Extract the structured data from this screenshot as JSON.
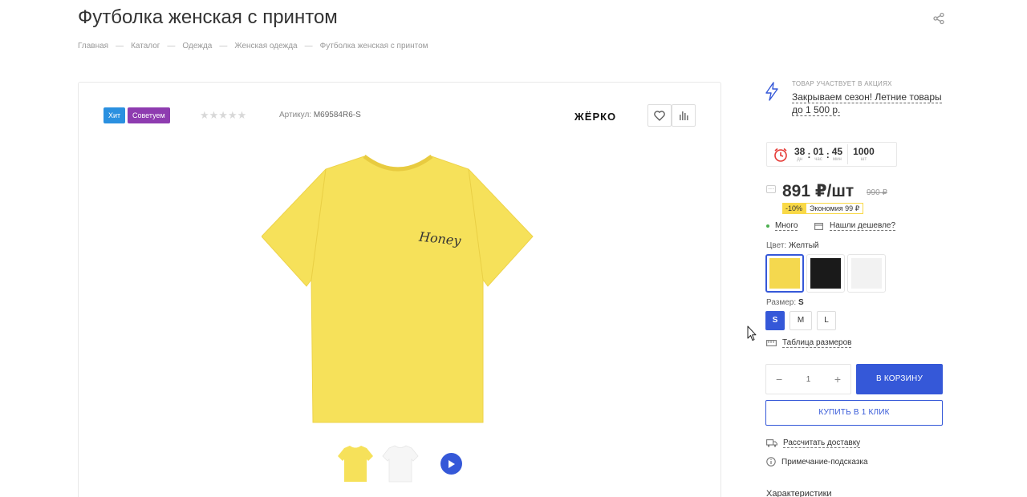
{
  "product": {
    "title": "Футболка женская с принтом",
    "badge_hit": "Хит",
    "badge_recommend": "Советуем",
    "rating_stars": "★★★★★",
    "article_label": "Артикул:",
    "article_value": "M69584R6-S",
    "brand": "ЖЁРКО"
  },
  "breadcrumb": [
    "Главная",
    "Каталог",
    "Одежда",
    "Женская одежда",
    "Футболка женская с принтом"
  ],
  "breadcrumb_separator": "—",
  "tshirt_print_text": "Honey",
  "promo": {
    "label": "Товар участвует в акциях",
    "text": "Закрываем сезон! Летние товары до 1 500 р."
  },
  "timer": {
    "days": "38",
    "days_unit": "дн",
    "hours": "01",
    "hours_unit": "час",
    "minutes": "45",
    "minutes_unit": "мин",
    "qty": "1000",
    "qty_unit": "шт"
  },
  "price": {
    "current": "891 ₽/шт",
    "old": "990 ₽",
    "discount": "-10%",
    "economy": "Экономия 99 ₽"
  },
  "availability": {
    "stock": "Много",
    "cheaper": "Нашли дешевле?"
  },
  "color": {
    "label": "Цвет:",
    "value": "Желтый",
    "swatches": [
      "#f4d84e",
      "#1a1a1a",
      "#f2f2f2"
    ]
  },
  "size": {
    "label": "Размер:",
    "value": "S",
    "options": [
      "S",
      "M",
      "L"
    ],
    "table_link": "Таблица размеров"
  },
  "cart": {
    "quantity": "1",
    "minus": "−",
    "plus": "+",
    "add_label": "В КОРЗИНУ",
    "one_click_label": "КУПИТЬ В 1 КЛИК"
  },
  "info": {
    "delivery": "Рассчитать доставку",
    "hint": "Примечание-подсказка",
    "characteristics": "Характеристики"
  },
  "colors": {
    "accent": "#3558d8",
    "tshirt": "#f6e15a"
  }
}
